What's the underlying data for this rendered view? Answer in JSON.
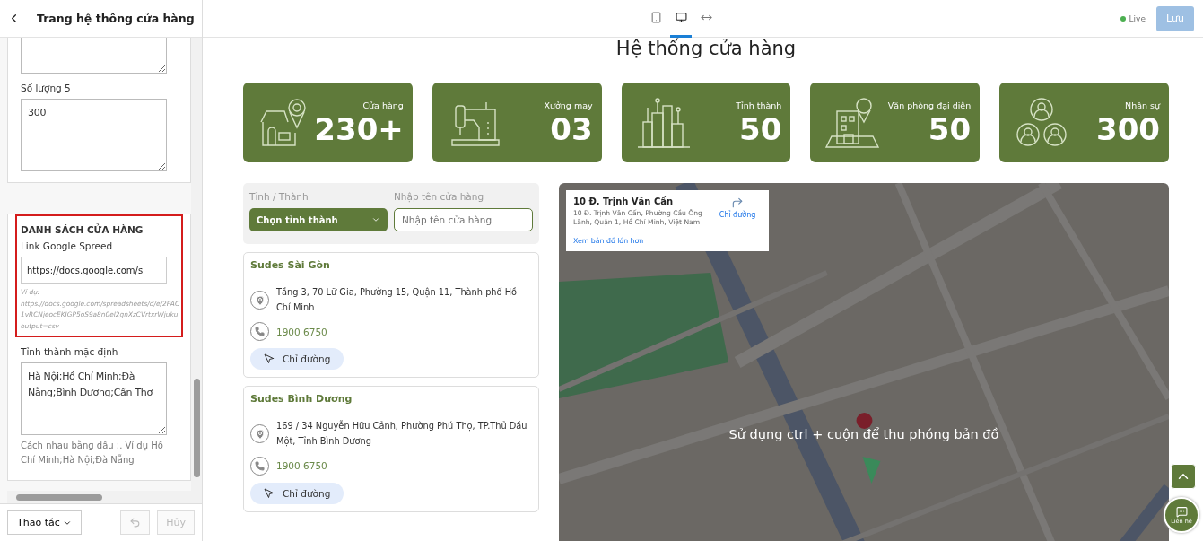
{
  "sidebar": {
    "title": "Trang hệ thống cửa hàng",
    "fields": [
      {
        "kind": "textarea"
      },
      {
        "kind": "textarea",
        "label": "Số lượng 5",
        "value": "300"
      }
    ],
    "section": {
      "title": "DANH SÁCH CỬA HÀNG",
      "highlighted": true,
      "link_label": "Link Google Spreed",
      "link_value": "https://docs.google.com/s",
      "hint_lines": [
        "Ví dụ:",
        "https://docs.google.com/spreadsheets/d/e/2PAC",
        "1vRCNjeocEKIGP5oS9a8n0el2gnXzCVrtxrWjuku",
        "output=csv"
      ],
      "default_label": "Tỉnh thành mặc định",
      "default_value": "Hà Nội;Hồ Chí Minh;Đà Nẵng;Bình Dương;Cần Thơ",
      "default_help": "Cách nhau bằng dấu ;. Ví dụ Hồ Chí Minh;Hà Nội;Đà Nẵng"
    },
    "footer": {
      "actions": "Thao tác",
      "cancel": "Hủy"
    }
  },
  "topbar": {
    "devices": [
      {
        "kind": "tablet",
        "selected": false
      },
      {
        "kind": "desktop",
        "selected": true
      },
      {
        "kind": "fullwidth",
        "selected": false
      }
    ],
    "status": "Live",
    "save": "Lưu"
  },
  "page": {
    "title": "Hệ thống cửa hàng",
    "stats": [
      {
        "kind": "store",
        "label": "Cửa hàng",
        "value": "230+"
      },
      {
        "kind": "sewing",
        "label": "Xưởng may",
        "value": "03"
      },
      {
        "kind": "city",
        "label": "Tỉnh thành",
        "value": "50"
      },
      {
        "kind": "office",
        "label": "Văn phòng đại diện",
        "value": "50"
      },
      {
        "kind": "people",
        "label": "Nhân sự",
        "value": "300"
      }
    ],
    "filter": {
      "province_label": "Tỉnh / Thành",
      "province_value": "Chọn tỉnh thành",
      "name_label": "Nhập tên cửa hàng",
      "name_placeholder": "Nhập tên cửa hàng"
    },
    "stores": [
      {
        "name": "Sudes Sài Gòn",
        "address": "Tầng 3, 70 Lữ Gia, Phường 15, Quận 11, Thành phố Hồ Chí Minh",
        "phone": "1900 6750",
        "directions": "Chỉ đường"
      },
      {
        "name": "Sudes Bình Dương",
        "address": "169 / 34 Nguyễn Hữu Cảnh, Phường Phú Thọ, TP.Thủ Dầu Một, Tỉnh Bình Dương",
        "phone": "1900 6750",
        "directions": "Chỉ đường"
      }
    ],
    "map": {
      "kind": "picture",
      "place_title": "10 Đ. Trịnh Văn Cấn",
      "place_address": "10 Đ. Trịnh Văn Cấn, Phường Cầu Ông Lãnh, Quận 1, Hồ Chí Minh, Việt Nam",
      "directions": "Chỉ đường",
      "larger": "Xem bản đồ lớn hơn",
      "overlay": "Sử dụng ctrl + cuộn để thu phóng bản đồ"
    },
    "contact": "Liên hệ"
  }
}
